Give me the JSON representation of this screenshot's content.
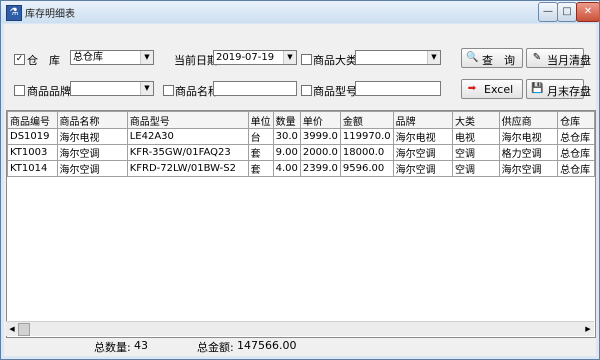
{
  "window": {
    "title": "库存明细表"
  },
  "filters": {
    "warehouse_label": "仓　库",
    "warehouse_value": "总仓库",
    "date_label": "当前日期",
    "date_value": "2019-07-19",
    "category_label": "商品大类",
    "category_value": "",
    "brand_label": "商品品牌",
    "brand_value": "",
    "name_label": "商品名称",
    "name_value": "",
    "model_label": "商品型号",
    "model_value": ""
  },
  "buttons": {
    "query": "查　询",
    "month_clear": "当月清盘",
    "excel": "Excel",
    "month_end": "月末存盘"
  },
  "table": {
    "columns": [
      "商品编号",
      "商品名称",
      "商品型号",
      "单位",
      "数量",
      "单价",
      "金额",
      "品牌",
      "大类",
      "供应商",
      "仓库"
    ],
    "rows": [
      [
        "DS1019",
        "海尔电视",
        "LE42A30",
        "台",
        "30.0",
        "3999.0",
        "119970.0",
        "海尔电视",
        "电视",
        "海尔电视",
        "总仓库"
      ],
      [
        "KT1003",
        "海尔空调",
        "KFR-35GW/01FAQ23",
        "套",
        "9.00",
        "2000.0",
        "18000.0",
        "海尔空调",
        "空调",
        "格力空调",
        "总仓库"
      ],
      [
        "KT1014",
        "海尔空调",
        "KFRD-72LW/01BW-S2",
        "套",
        "4.00",
        "2399.0",
        "9596.00",
        "海尔空调",
        "空调",
        "海尔空调",
        "总仓库"
      ]
    ]
  },
  "footer": {
    "total_qty_label": "总数量:",
    "total_qty_value": "43",
    "total_amount_label": "总金额:",
    "total_amount_value": "147566.00"
  },
  "icons": {
    "app": "app-icon",
    "query": "magnifier-icon",
    "month_clear": "pencil-icon",
    "excel": "red-arrow-icon",
    "month_end": "floppy-disk-icon"
  },
  "colors": {
    "titlebar": "#cddff1",
    "close_button": "#c9513a",
    "excel_arrow": "#d62020"
  }
}
